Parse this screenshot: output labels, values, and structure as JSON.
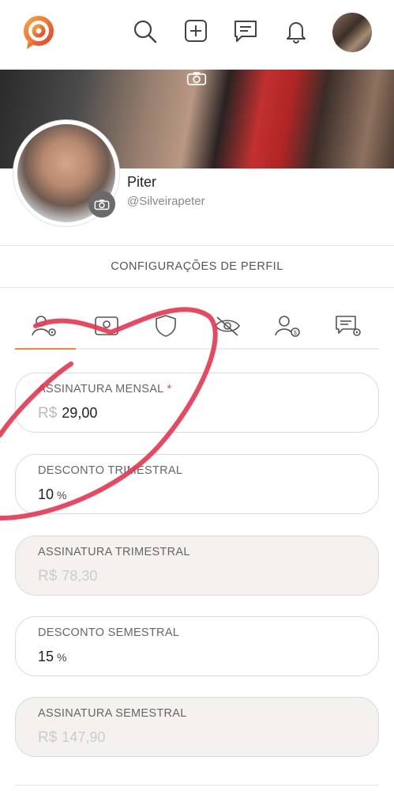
{
  "profile": {
    "name": "Piter",
    "handle": "@Silveirapeter"
  },
  "section": {
    "title": "CONFIGURAÇÕES DE PERFIL"
  },
  "nav": {
    "icons": [
      "search-icon",
      "add-post-icon",
      "messages-icon",
      "bell-icon"
    ]
  },
  "tabs": [
    "profile-settings-icon",
    "cover-image-icon",
    "security-shield-icon",
    "privacy-eye-icon",
    "subscription-price-icon",
    "message-settings-icon"
  ],
  "fields": {
    "monthly": {
      "label": "ASSINATURA MENSAL",
      "required": "*",
      "currency": "R$",
      "value": "29,00"
    },
    "quarterly_discount": {
      "label": "DESCONTO TRIMESTRAL",
      "value": "10",
      "unit": "%"
    },
    "quarterly": {
      "label": "ASSINATURA TRIMESTRAL",
      "currency": "R$",
      "value": "78,30"
    },
    "semiannual_discount": {
      "label": "DESCONTO SEMESTRAL",
      "value": "15",
      "unit": "%"
    },
    "semiannual": {
      "label": "ASSINATURA SEMESTRAL",
      "currency": "R$",
      "value": "147,90"
    }
  },
  "colors": {
    "accent": "#ef8a3a",
    "required": "#e34b4b",
    "annotation": "#e8334f"
  }
}
